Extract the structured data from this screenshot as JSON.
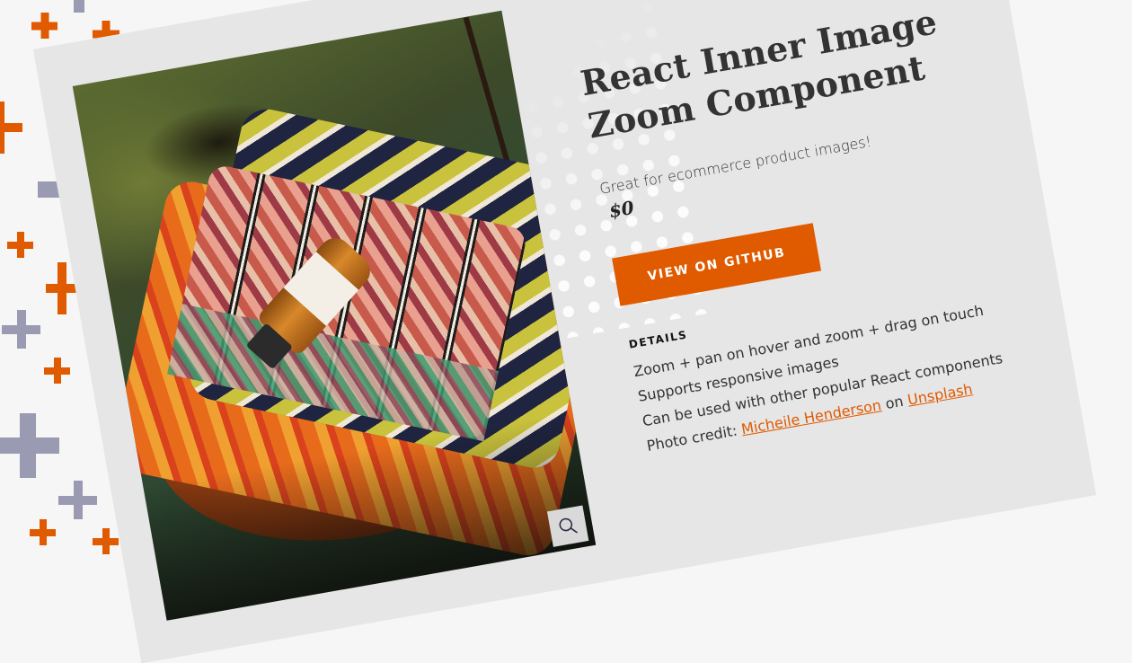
{
  "product": {
    "title_line1": "React Inner Image",
    "title_line2": "Zoom Component",
    "tagline": "Great for ecommerce product images!",
    "price": "$0",
    "cta_label": "VIEW ON GITHUB"
  },
  "details": {
    "heading": "DETAILS",
    "items": [
      "Zoom + pan on hover and zoom + drag on touch",
      "Supports responsive images",
      "Can be used with other popular React components"
    ],
    "credit": {
      "prefix": "Photo credit: ",
      "author_link": "Micheile Henderson",
      "middle": " on ",
      "source_link": "Unsplash"
    }
  },
  "image": {
    "alt_semantic": "stack of colorful patterned blankets with amber bottle on wooden table",
    "zoom_icon": "magnifier-icon"
  },
  "colors": {
    "accent": "#e05a00",
    "background": "#f6f6f6",
    "decor_gray": "#9a9ab2",
    "text": "#333333"
  }
}
